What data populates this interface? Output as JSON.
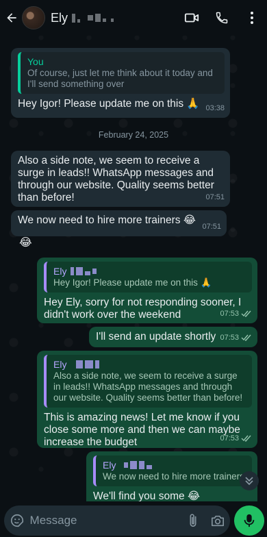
{
  "header": {
    "contact_name": "Ely",
    "icons": [
      "back-arrow-icon",
      "video-call-icon",
      "phone-icon",
      "more-vertical-icon"
    ]
  },
  "messages": {
    "m1": {
      "quote_name": "You",
      "quote_text": "Of course, just let me think about it today and I'll send something over",
      "text": "Hey Igor! Please update me on this 🙏",
      "time": "03:38"
    },
    "date_divider": "February 24, 2025",
    "m2": {
      "text": "Also a side note, we seem to receive a surge in leads!! WhatsApp messages and through our website. Quality seems better than before!",
      "time": "07:51"
    },
    "m3": {
      "text": "We now need to hire more trainers 😂",
      "time": "07:51"
    },
    "m4": {
      "text": "😂"
    },
    "m5": {
      "quote_name": "Ely",
      "quote_text": "Hey Igor! Please update me on this 🙏",
      "text": "Hey Ely, sorry for not responding sooner, I didn't work over the weekend",
      "time": "07:53"
    },
    "m6": {
      "text": "I'll send an update shortly",
      "time": "07:53"
    },
    "m7": {
      "quote_name": "Ely",
      "quote_text": "Also a side note, we seem to receive a surge in leads!! WhatsApp messages and through our website. Quality seems better than before!",
      "text": "This is amazing news! Let me know if you close some more and then we can maybe increase the budget",
      "time": "07:53"
    },
    "m8": {
      "quote_name": "Ely",
      "quote_text": "We now need to hire more trainers 😂",
      "text": "We'll find you some 😂"
    }
  },
  "input": {
    "placeholder": "Message"
  },
  "colors": {
    "incoming_bubble": "#1f2c34",
    "outgoing_bubble": "#134d37",
    "accent_green": "#21c063",
    "background": "#0b1014",
    "read_ticks": "#96c4ae"
  }
}
